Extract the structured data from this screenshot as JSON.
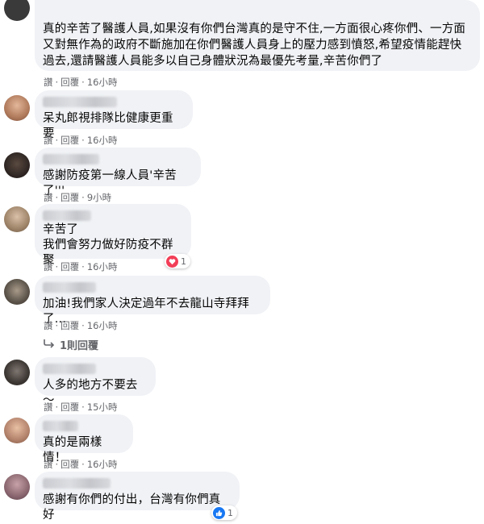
{
  "action_labels": {
    "like": "讚",
    "reply": "回覆",
    "dot": "·"
  },
  "comments": [
    {
      "text": "真的辛苦了醫護人員,如果沒有你們台灣真的是守不住,一方面很心疼你們、一方面又對無作為的政府不斷施加在你們醫護人員身上的壓力感到憤怒,希望疫情能趕快過去,還請醫護人員能多以自己身體狀況為最優先考量,辛苦你們了",
      "time": "16小時"
    },
    {
      "text": "呆丸郎視排隊比健康更重要",
      "time": "16小時"
    },
    {
      "text": "感謝防疫第一線人員'辛苦了'''",
      "time": "9小時"
    },
    {
      "text": "辛苦了\n我們會努力做好防疫不群聚",
      "time": "16小時",
      "reaction": {
        "icon": "love-icon",
        "count": "1",
        "color": "#f33e58"
      }
    },
    {
      "text": "加油!我們家人決定過年不去龍山寺拜拜了...",
      "time": "16小時"
    },
    {
      "text": "人多的地方不要去～",
      "time": "15小時"
    },
    {
      "text": "真的是兩樣情！",
      "time": "16小時"
    },
    {
      "text": "感謝有你們的付出，台灣有你們真好",
      "time": "16小時",
      "reaction": {
        "icon": "like-icon",
        "count": "1",
        "color": "#1877f2"
      }
    }
  ],
  "reply_thread": {
    "label": "1則回覆"
  }
}
